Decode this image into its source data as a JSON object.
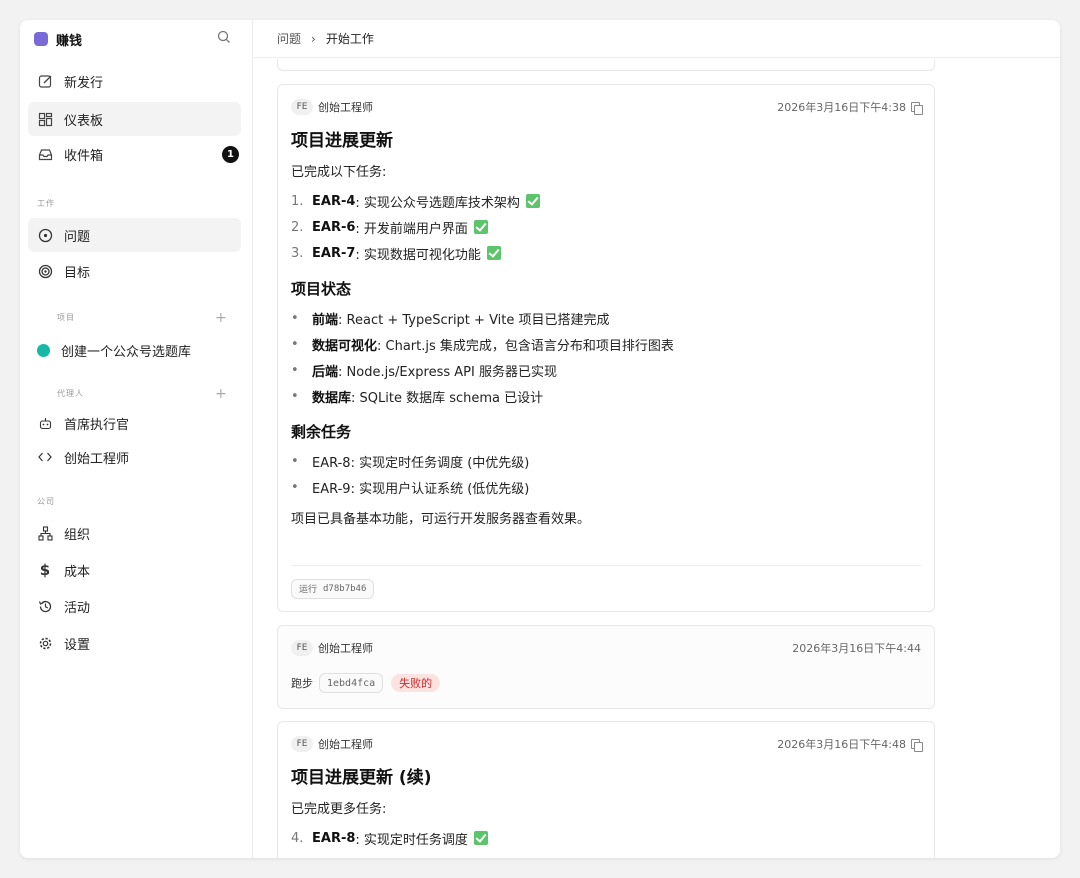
{
  "sidebar": {
    "brand": "赚钱",
    "nav": [
      {
        "label": "新发行",
        "icon": "edit-icon"
      },
      {
        "label": "仪表板",
        "icon": "dashboard-icon"
      },
      {
        "label": "收件箱",
        "icon": "inbox-icon",
        "badge": "1"
      }
    ],
    "work_label": "工作",
    "work_items": [
      {
        "label": "问题",
        "icon": "issue-icon"
      },
      {
        "label": "目标",
        "icon": "target-icon"
      }
    ],
    "projects_label": "项目",
    "projects": [
      {
        "label": "创建一个公众号选题库",
        "color": "#17b8a6"
      }
    ],
    "agents_label": "代理人",
    "agents": [
      {
        "label": "首席执行官",
        "icon": "bot-icon"
      },
      {
        "label": "创始工程师",
        "icon": "code-icon"
      }
    ],
    "company_label": "公司",
    "company_items": [
      {
        "label": "组织",
        "icon": "org-icon"
      },
      {
        "label": "成本",
        "icon": "dollar-icon"
      },
      {
        "label": "活动",
        "icon": "history-icon"
      },
      {
        "label": "设置",
        "icon": "settings-icon"
      }
    ]
  },
  "breadcrumb": {
    "parent": "问题",
    "separator": "›",
    "current": "开始工作"
  },
  "cards": [
    {
      "avatar": "FE",
      "author": "创始工程师",
      "timestamp": "2026年3月16日下午4:38",
      "title": "项目进展更新",
      "intro": "已完成以下任务:",
      "done": [
        {
          "n": "1.",
          "key": "EAR-4",
          "text": ": 实现公众号选题库技术架构"
        },
        {
          "n": "2.",
          "key": "EAR-6",
          "text": ": 开发前端用户界面"
        },
        {
          "n": "3.",
          "key": "EAR-7",
          "text": ": 实现数据可视化功能"
        }
      ],
      "status_heading": "项目状态",
      "status": [
        {
          "key": "前端",
          "text": ": React + TypeScript + Vite 项目已搭建完成"
        },
        {
          "key": "数据可视化",
          "text": ": Chart.js 集成完成，包含语言分布和项目排行图表"
        },
        {
          "key": "后端",
          "text": ": Node.js/Express API 服务器已实现"
        },
        {
          "key": "数据库",
          "text": ": SQLite 数据库 schema 已设计"
        }
      ],
      "remain_heading": "剩余任务",
      "remain": [
        "EAR-8: 实现定时任务调度 (中优先级)",
        "EAR-9: 实现用户认证系统 (低优先级)"
      ],
      "summary": "项目已具备基本功能，可运行开发服务器查看效果。",
      "run_label": "运行",
      "run_id": "d78b7b46"
    },
    {
      "avatar": "FE",
      "author": "创始工程师",
      "timestamp": "2026年3月16日下午4:44",
      "run_label": "跑步",
      "run_id": "1ebd4fca",
      "status": "失败的"
    },
    {
      "avatar": "FE",
      "author": "创始工程师",
      "timestamp": "2026年3月16日下午4:48",
      "title": "项目进展更新 (续)",
      "intro": "已完成更多任务:",
      "done": [
        {
          "n": "4.",
          "key": "EAR-8",
          "text": ": 实现定时任务调度"
        }
      ]
    }
  ]
}
